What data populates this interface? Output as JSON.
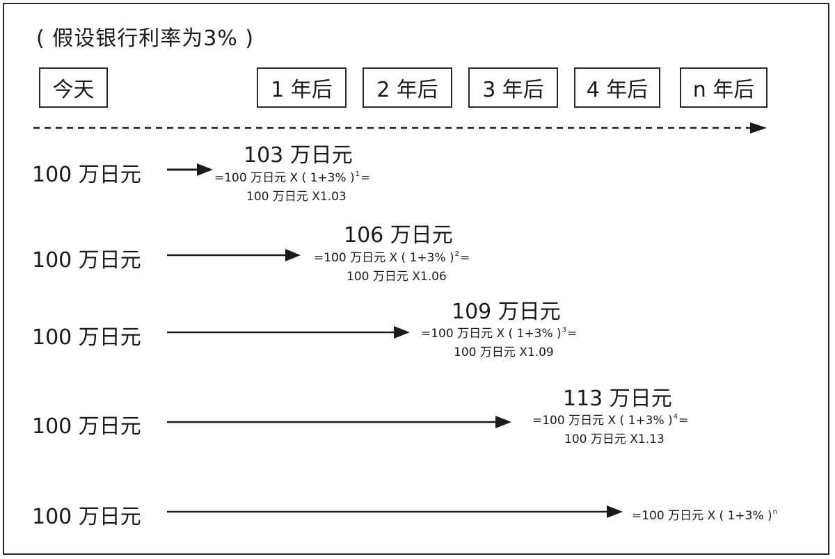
{
  "title": "( 假设银行利率为3% )",
  "timeline": {
    "today": "今天",
    "years": [
      "1 年后",
      "2 年后",
      "3 年后",
      "4 年后",
      "n 年后"
    ]
  },
  "rows": [
    {
      "start": "100 万日元",
      "result": "103 万日元",
      "formula_prefix": "=100 万日元 X ( 1+3% )",
      "exponent": "1",
      "formula_suffix": "=",
      "simplified": "100 万日元 X1.03"
    },
    {
      "start": "100 万日元",
      "result": "106 万日元",
      "formula_prefix": "=100 万日元 X ( 1+3% )",
      "exponent": "2",
      "formula_suffix": "=",
      "simplified": "100 万日元 X1.06"
    },
    {
      "start": "100 万日元",
      "result": "109 万日元",
      "formula_prefix": "=100 万日元 X ( 1+3% )",
      "exponent": "3",
      "formula_suffix": "=",
      "simplified": "100 万日元 X1.09"
    },
    {
      "start": "100 万日元",
      "result": "113 万日元",
      "formula_prefix": "=100 万日元 X ( 1+3% )",
      "exponent": "4",
      "formula_suffix": "=",
      "simplified": "100 万日元 X1.13"
    },
    {
      "start": "100 万日元",
      "formula_prefix": "=100 万日元 X ( 1+3% )",
      "exponent": "n"
    }
  ],
  "colors": {
    "ink": "#1a1a1a"
  }
}
